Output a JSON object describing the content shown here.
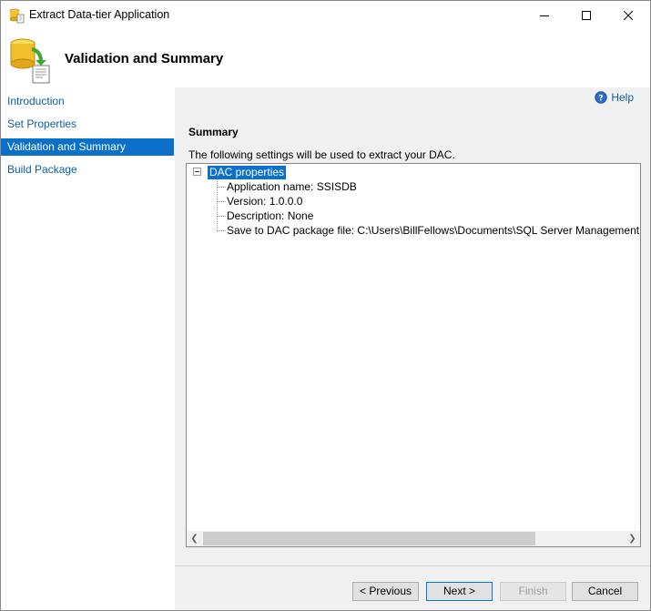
{
  "window": {
    "title": "Extract Data-tier Application"
  },
  "header": {
    "title": "Validation and Summary"
  },
  "nav": {
    "items": [
      {
        "label": "Introduction"
      },
      {
        "label": "Set Properties"
      },
      {
        "label": "Validation and Summary"
      },
      {
        "label": "Build Package"
      }
    ],
    "active_index": 2
  },
  "content": {
    "help_label": "Help",
    "summary_heading": "Summary",
    "summary_description": "The following settings will be used to extract your DAC.",
    "tree": {
      "root_label": "DAC properties",
      "children": [
        "Application name: SSISDB",
        "Version: 1.0.0.0",
        "Description: None",
        "Save to DAC package file: C:\\Users\\BillFellows\\Documents\\SQL Server Management Studio\\DAC Packages\\SSISDB.dacpac"
      ]
    }
  },
  "buttons": {
    "previous": "< Previous",
    "next": "Next >",
    "finish": "Finish",
    "cancel": "Cancel"
  },
  "colors": {
    "accent": "#0a70c9",
    "link": "#0f5fa8"
  }
}
